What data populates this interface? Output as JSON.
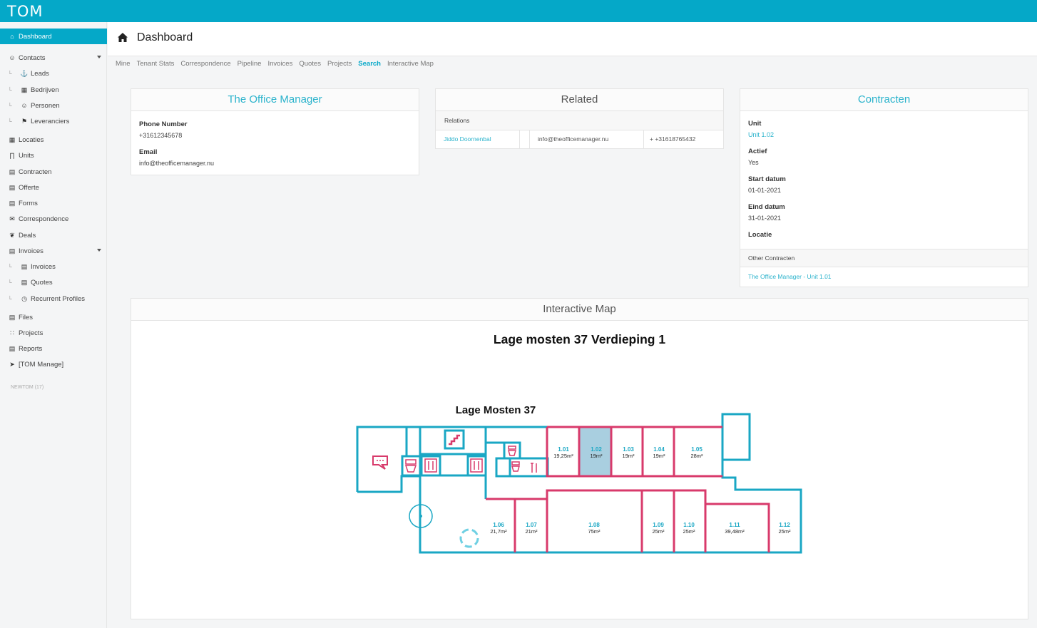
{
  "app": {
    "logo": "TOM"
  },
  "sidebar": {
    "items": [
      {
        "label": "Dashboard",
        "icon": "home-icon",
        "active": true
      },
      {
        "label": "Contacts",
        "icon": "users-icon",
        "caret": true
      },
      {
        "label": "Leads",
        "icon": "anchor-icon",
        "child": true
      },
      {
        "label": "Bedrijven",
        "icon": "building-icon",
        "child": true
      },
      {
        "label": "Personen",
        "icon": "users-icon",
        "child": true
      },
      {
        "label": "Leveranciers",
        "icon": "flag-icon",
        "child": true
      },
      {
        "label": "Locaties",
        "icon": "building-icon"
      },
      {
        "label": "Units",
        "icon": "door-icon"
      },
      {
        "label": "Contracten",
        "icon": "file-icon"
      },
      {
        "label": "Offerte",
        "icon": "file-icon"
      },
      {
        "label": "Forms",
        "icon": "file-icon"
      },
      {
        "label": "Correspondence",
        "icon": "envelope-icon"
      },
      {
        "label": "Deals",
        "icon": "handshake-icon"
      },
      {
        "label": "Invoices",
        "icon": "file-icon",
        "caret": true
      },
      {
        "label": "Invoices",
        "icon": "file-icon",
        "child": true
      },
      {
        "label": "Quotes",
        "icon": "file-icon",
        "child": true
      },
      {
        "label": "Recurrent Profiles",
        "icon": "clock-icon",
        "child": true
      },
      {
        "label": "Files",
        "icon": "file-icon"
      },
      {
        "label": "Projects",
        "icon": "sitemap-icon"
      },
      {
        "label": "Reports",
        "icon": "file-icon"
      },
      {
        "label": "[TOM Manage]",
        "icon": "rocket-icon"
      }
    ],
    "footer": "NEWTOM (17)"
  },
  "header": {
    "title": "Dashboard"
  },
  "subnav": {
    "tabs": [
      "Mine",
      "Tenant Stats",
      "Correspondence",
      "Pipeline",
      "Invoices",
      "Quotes",
      "Projects",
      "Search",
      "Interactive Map"
    ],
    "active": "Search"
  },
  "contact_panel": {
    "title": "The Office Manager",
    "phone_label": "Phone Number",
    "phone": "+31612345678",
    "email_label": "Email",
    "email": "info@theofficemanager.nu"
  },
  "related_panel": {
    "title": "Related",
    "subheader": "Relations",
    "row": {
      "name": "Jiddo Doornenbal",
      "email": "info@theofficemanager.nu",
      "phone": "+ +31618765432"
    }
  },
  "contract_panel": {
    "title": "Contracten",
    "fields": [
      {
        "label": "Unit",
        "value": "Unit 1.02",
        "link": true
      },
      {
        "label": "Actief",
        "value": "Yes"
      },
      {
        "label": "Start datum",
        "value": "01-01-2021"
      },
      {
        "label": "Eind datum",
        "value": "31-01-2021"
      },
      {
        "label": "Locatie",
        "value": ""
      }
    ],
    "other_header": "Other Contracten",
    "other_link": "The Office Manager - Unit 1.01"
  },
  "map_panel": {
    "title": "Interactive Map",
    "map_title": "Lage mosten 37 Verdieping 1",
    "plan_title": "Lage Mosten 37",
    "units": [
      {
        "id": "1.01",
        "area": "19,25m²",
        "selected": false
      },
      {
        "id": "1.02",
        "area": "19m²",
        "selected": true
      },
      {
        "id": "1.03",
        "area": "19m²",
        "selected": false
      },
      {
        "id": "1.04",
        "area": "19m²",
        "selected": false
      },
      {
        "id": "1.05",
        "area": "28m²",
        "selected": false
      },
      {
        "id": "1.06",
        "area": "21,7m²",
        "selected": false
      },
      {
        "id": "1.07",
        "area": "21m²",
        "selected": false
      },
      {
        "id": "1.08",
        "area": "75m²",
        "selected": false
      },
      {
        "id": "1.09",
        "area": "25m²",
        "selected": false
      },
      {
        "id": "1.10",
        "area": "25m²",
        "selected": false
      },
      {
        "id": "1.11",
        "area": "39,48m²",
        "selected": false
      },
      {
        "id": "1.12",
        "area": "25m²",
        "selected": false
      }
    ]
  },
  "colors": {
    "accent": "#05a8c8",
    "wall": "#1aa7c4",
    "unit_wall": "#d83a6b",
    "selected_fill": "#a9cfe0"
  }
}
